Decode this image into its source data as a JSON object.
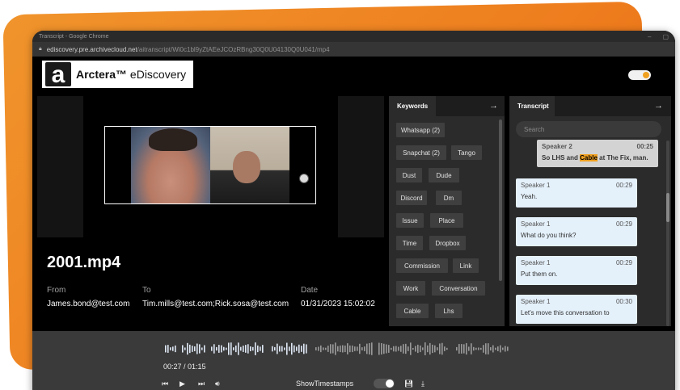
{
  "window": {
    "title": "Transcript - Google Chrome",
    "url_host": "ediscovery.pre.archivecloud.net",
    "url_path": "/aitranscript/Wi0c1bl9yZtAEeJCOzRBng30Q0U04130Q0U041/mp4"
  },
  "brand": {
    "logo_letter": "a",
    "name_bold": "Arctera™",
    "name_rest": " eDiscovery",
    "accent": "#f0a020",
    "orange_bg": "#ee7d1e"
  },
  "file": {
    "name": "2001.mp4",
    "from_label": "From",
    "from_value": "James.bond@test.com",
    "to_label": "To",
    "to_value": "Tim.mills@test.com;Rick.sosa@test.com",
    "date_label": "Date",
    "date_value": "01/31/2023 15:02:02"
  },
  "keywords": {
    "tab": "Keywords",
    "chips": [
      "Whatsapp (2)",
      "Snapchat (2)",
      "Tango",
      "Dust",
      "Dude",
      "Discord",
      "Dm",
      "Issue",
      "Place",
      "Time",
      "Dropbox",
      "Commission",
      "Link",
      "Work",
      "Conversation",
      "Cable",
      "Lhs"
    ]
  },
  "transcript": {
    "tab": "Transcript",
    "search_placeholder": "Search",
    "messages": [
      {
        "speaker": "Speaker 2",
        "time": "00:25",
        "pre": "So LHS and ",
        "hl": "Cable",
        "post": " at The Fix, man."
      },
      {
        "speaker": "Speaker 1",
        "time": "00:29",
        "text": "Yeah."
      },
      {
        "speaker": "Speaker 1",
        "time": "00:29",
        "text": "What do you think?"
      },
      {
        "speaker": "Speaker 1",
        "time": "00:29",
        "text": "Put them on."
      },
      {
        "speaker": "Speaker 1",
        "time": "00:30",
        "text": "Let's move this conversation to"
      }
    ]
  },
  "player": {
    "time": "00:27 / 01:15",
    "timestamps_label": "ShowTimestamps"
  },
  "icons": [
    "lock-icon",
    "export-arrow-icon",
    "skip-back-icon",
    "play-icon",
    "skip-forward-icon",
    "volume-icon",
    "save-icon",
    "download-icon"
  ]
}
